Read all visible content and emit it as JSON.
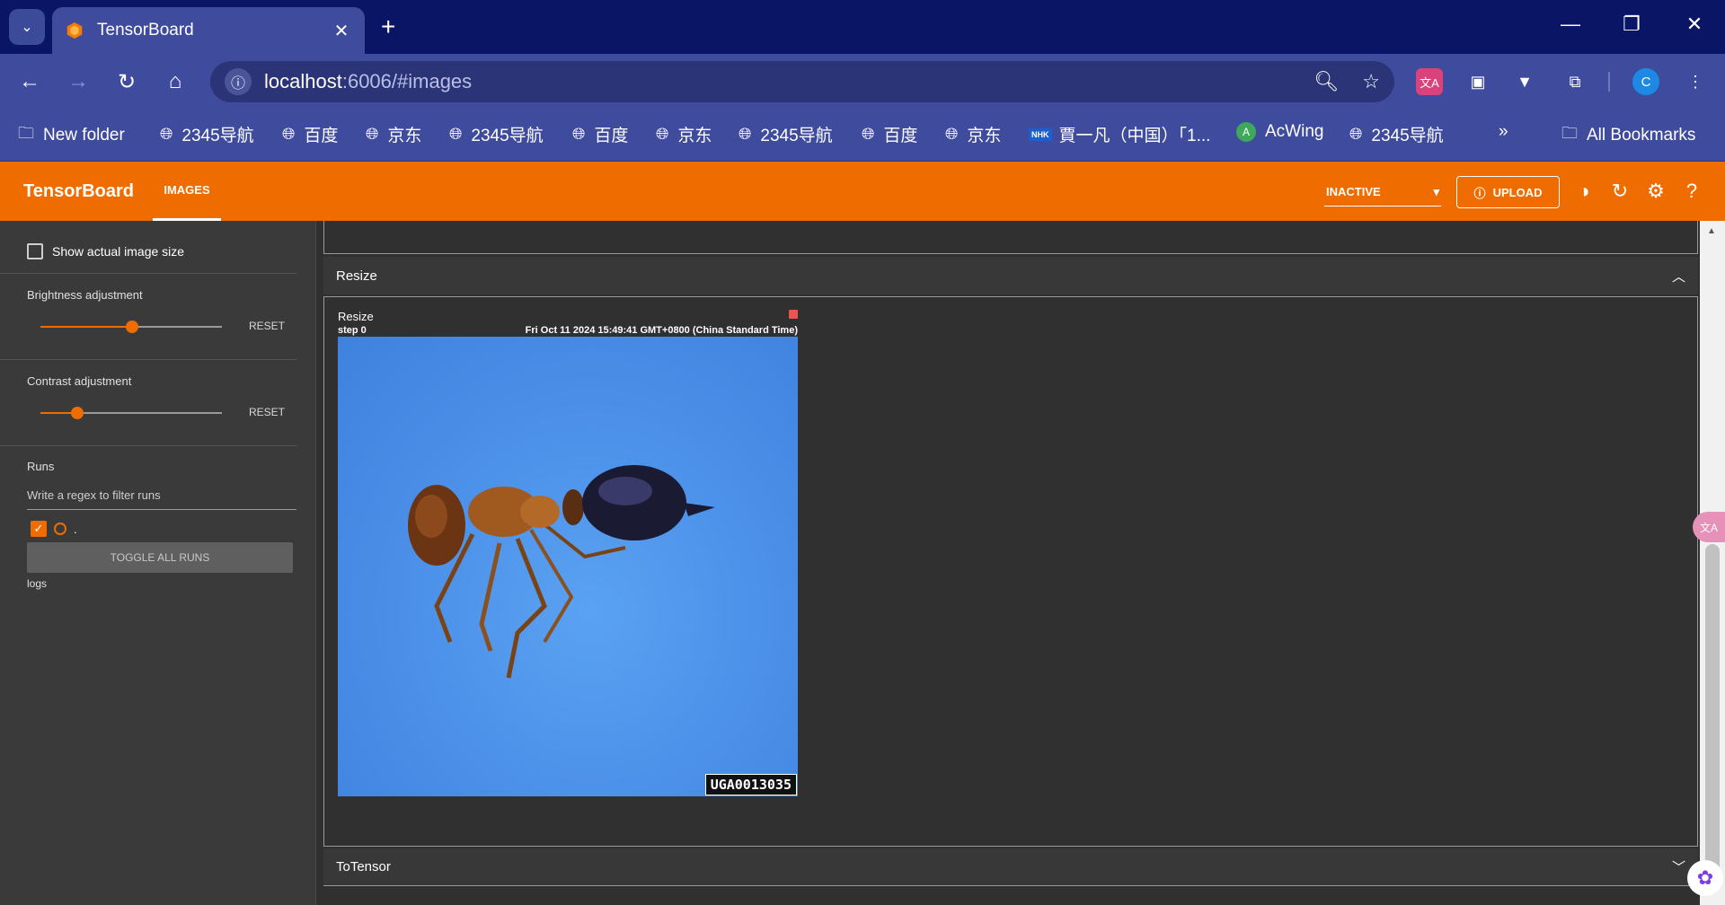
{
  "browser": {
    "tab_title": "TensorBoard",
    "url_host": "localhost",
    "url_rest": ":6006/#images",
    "bookmarks": [
      {
        "label": "New folder",
        "icon": "folder-icon"
      },
      {
        "label": "2345导航",
        "icon": "globe-icon"
      },
      {
        "label": "百度",
        "icon": "globe-icon"
      },
      {
        "label": "京东",
        "icon": "globe-icon"
      },
      {
        "label": "2345导航",
        "icon": "globe-icon"
      },
      {
        "label": "百度",
        "icon": "globe-icon"
      },
      {
        "label": "京东",
        "icon": "globe-icon"
      },
      {
        "label": "2345导航",
        "icon": "globe-icon"
      },
      {
        "label": "百度",
        "icon": "globe-icon"
      },
      {
        "label": "京东",
        "icon": "globe-icon"
      },
      {
        "label": "賈一凡（中国）「1...",
        "icon": "nhk-icon"
      },
      {
        "label": "AcWing",
        "icon": "acwing-icon"
      },
      {
        "label": "2345导航",
        "icon": "globe-icon"
      }
    ],
    "all_bookmarks": "All Bookmarks",
    "profile_initial": "C"
  },
  "tb": {
    "title": "TensorBoard",
    "tab_images": "IMAGES",
    "status": "INACTIVE",
    "upload": "UPLOAD"
  },
  "sidebar": {
    "show_actual_size": "Show actual image size",
    "brightness_label": "Brightness adjustment",
    "brightness_value": 0.5,
    "contrast_label": "Contrast adjustment",
    "contrast_value": 0.2,
    "reset": "RESET",
    "runs_label": "Runs",
    "runs_placeholder": "Write a regex to filter runs",
    "run_name": ".",
    "toggle_all": "TOGGLE ALL RUNS",
    "logs": "logs"
  },
  "main": {
    "group1_title": "Resize",
    "card_title": "Resize",
    "card_step": "step 0",
    "card_time": "Fri Oct 11 2024 15:49:41 GMT+0800 (China Standard Time)",
    "image_watermark": "UGA0013035",
    "group2_title": "ToTensor"
  },
  "colors": {
    "accent": "#ef6c00",
    "chrome_dark": "#0b1565",
    "chrome": "#3f4b9c"
  }
}
